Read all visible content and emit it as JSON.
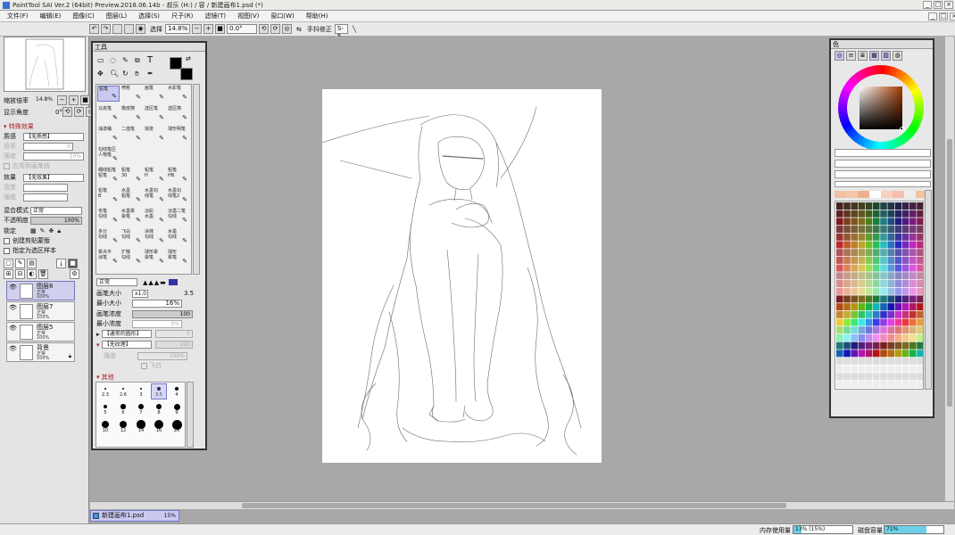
{
  "app": {
    "title": "PaintTool SAI Ver.2 (64bit) Preview.2018.06.14b - 叔乐 (H:) / 容 / 新建画布1.psd (*)",
    "minimize": "_",
    "maximize": "□",
    "close": "×"
  },
  "menu": [
    "文件(F)",
    "编辑(E)",
    "图像(C)",
    "图层(L)",
    "选择(S)",
    "尺子(R)",
    "滤镜(T)",
    "视图(V)",
    "窗口(W)",
    "帮助(H)"
  ],
  "toolbar": {
    "selection_label": "选择",
    "zoom_value": "14.8%",
    "rotation_value": "0.0°",
    "stabilizer_label": "手抖修正",
    "stabilizer_value": "S-5"
  },
  "navigator": {
    "zoom_label": "缩放倍率",
    "zoom_value": "14.8%",
    "rotation_label": "显示角度",
    "rotation_value": "0°"
  },
  "effects": {
    "header": "特殊效果",
    "texture_label": "质感",
    "texture_value": "【无质感】",
    "texture_scale_label": "倍率",
    "texture_scale_value": "0",
    "texture_strength_label": "强度",
    "texture_strength_value": "10%",
    "apply_brush_label": "应用到画笔线",
    "effect_label": "效果",
    "effect_value": "【无效果】",
    "effect_width_label": "宽度",
    "effect_width_value": "",
    "effect_strength_label": "强度",
    "effect_strength_value": ""
  },
  "blend": {
    "mode_label": "混合模式",
    "mode_value": "正常",
    "opacity_label": "不透明度",
    "opacity_value": "100%",
    "lock_label": "锁定",
    "clip_label": "创建剪贴蒙版",
    "select_source_label": "指定为选区样本"
  },
  "layers": [
    {
      "name": "图层8",
      "mode": "正常",
      "opacity": "100%",
      "selected": true
    },
    {
      "name": "图层7",
      "mode": "正常",
      "opacity": "100%",
      "selected": false
    },
    {
      "name": "图层5",
      "mode": "正常",
      "opacity": "100%",
      "selected": false
    },
    {
      "name": "背景",
      "mode": "正常",
      "opacity": "100%",
      "selected": false
    }
  ],
  "tools": {
    "header": "工具",
    "brushes": [
      "铅笔",
      "喷枪",
      "画笔",
      "水彩笔",
      "马克笔",
      "橡皮擦",
      "选区笔",
      "选区擦",
      "油漆桶",
      "二值笔",
      "渐变",
      "球形明笔",
      "勾线笔区\n人物笔",
      "",
      "",
      "",
      "细线铅笔\n铅笔",
      "铅笔\n30",
      "铅笔\nH",
      "铅笔\nHB",
      "铅笔\nB",
      "水墨\n铅笔",
      "水墨勾\n线笔",
      "水墨勾\n线笔2",
      "毛笔\n勾线",
      "水墨晕\n染笔",
      "淡彩\n水墨",
      "淡墨二笔\n勾线",
      "多分\n勾线",
      "飞白\n勾线",
      "涂抹\n勾线",
      "水墨\n勾线",
      "晕点平\n涂笔",
      "扩散\n勾线",
      "球形晕\n染笔",
      "球形\n晕笔"
    ],
    "blend_mode": "正常",
    "size_label": "画笔大小",
    "size_multiplier": "x1.0",
    "size_value": "3.5",
    "min_size_label": "最小大小",
    "min_size_value": "16%",
    "density_label": "画笔浓度",
    "density_value": "100",
    "min_density_label": "最小浓度",
    "min_density_value": "0%",
    "shape_value": "【通常的圆形】",
    "shape_value2": "0",
    "texture_value": "【无纹理】",
    "texture_value2": "100",
    "strength_label": "强度",
    "strength_value": "100%",
    "flyout_label": "飞白",
    "other_label": "其他",
    "sizes": [
      "2.3",
      "2.6",
      "3",
      "3.5",
      "4",
      "5",
      "6",
      "7",
      "8",
      "9",
      "10",
      "12",
      "14",
      "16",
      "20"
    ]
  },
  "color": {
    "header": "色",
    "accent": "#6060c0",
    "primary": "#000000",
    "secondary": "#ffffff"
  },
  "document": {
    "tab_name": "新建画布1.psd",
    "zoom": "15%"
  },
  "status": {
    "memory_label": "内存使用量",
    "memory_value": "13% (15%)",
    "memory_fraction": 0.13,
    "disk_label": "磁盘容量",
    "disk_value": "71%",
    "disk_fraction": 0.71
  }
}
